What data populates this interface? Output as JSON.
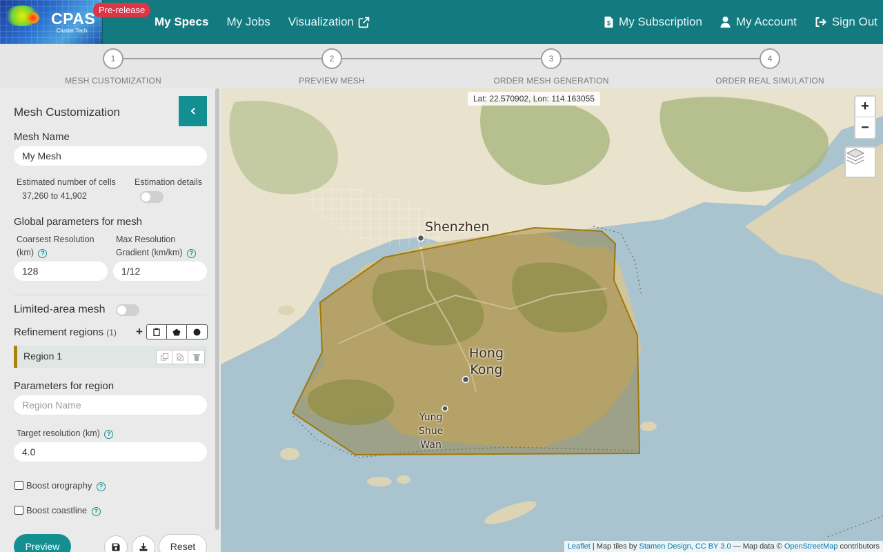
{
  "app": {
    "brand": "CPAS",
    "brand_sub": "Cluster Tech",
    "badge": "Pre-release"
  },
  "nav": {
    "left": [
      {
        "label": "My Specs",
        "active": true
      },
      {
        "label": "My Jobs"
      },
      {
        "label": "Visualization",
        "icon": "external-link-icon"
      }
    ],
    "right": [
      {
        "label": "My Subscription",
        "icon": "file-invoice-dollar-icon"
      },
      {
        "label": "My Account",
        "icon": "user-icon"
      },
      {
        "label": "Sign Out",
        "icon": "sign-out-icon"
      }
    ]
  },
  "steps": [
    {
      "num": "1",
      "label": "MESH CUSTOMIZATION"
    },
    {
      "num": "2",
      "label": "PREVIEW MESH"
    },
    {
      "num": "3",
      "label": "ORDER MESH GENERATION"
    },
    {
      "num": "4",
      "label": "ORDER REAL SIMULATION"
    }
  ],
  "sidebar": {
    "title": "Mesh Customization",
    "mesh_name_label": "Mesh Name",
    "mesh_name_value": "My Mesh",
    "est_cells_label": "Estimated number of cells",
    "est_cells_value": "37,260 to 41,902",
    "est_details_label": "Estimation details",
    "est_details_on": false,
    "global_params_label": "Global parameters for mesh",
    "coarsest_label_1": "Coarsest Resolution",
    "coarsest_label_2": "(km)",
    "coarsest_value": "128",
    "gradient_label_1": "Max Resolution",
    "gradient_label_2": "Gradient (km/km)",
    "gradient_value": "1/12",
    "limited_area_label": "Limited-area mesh",
    "limited_area_on": false,
    "refinement_label": "Refinement regions",
    "refinement_count": "(1)",
    "regions": [
      {
        "name": "Region 1"
      }
    ],
    "region_params_label": "Parameters for region",
    "region_name_placeholder": "Region Name",
    "target_res_label": "Target resolution (km)",
    "target_res_value": "4.0",
    "boost_orography_label": "Boost orography",
    "boost_orography_checked": false,
    "boost_coastline_label": "Boost coastline",
    "boost_coastline_checked": false,
    "preview_label": "Preview",
    "reset_label": "Reset"
  },
  "map": {
    "coords": "Lat: 22.570902, Lon: 114.163055",
    "zoom_in": "+",
    "zoom_out": "−",
    "cities": [
      {
        "name": "Shenzhen"
      },
      {
        "name_lines": [
          "Hong",
          "Kong"
        ]
      },
      {
        "name_lines": [
          "Yung",
          "Shue",
          "Wan"
        ]
      }
    ],
    "attribution": {
      "leaflet": "Leaflet",
      "tiles_prefix": " | Map tiles by ",
      "stamen": "Stamen Design",
      "comma": ", ",
      "license": "CC BY 3.0",
      "data_prefix": " — Map data © ",
      "osm": "OpenStreetMap",
      "suffix": " contributors"
    },
    "colors": {
      "water": "#a9c3cf",
      "land": "#e9e2cd",
      "forest": "#a9b87f",
      "region_fill": "#8a6a14",
      "region_stroke": "#a07808"
    }
  }
}
